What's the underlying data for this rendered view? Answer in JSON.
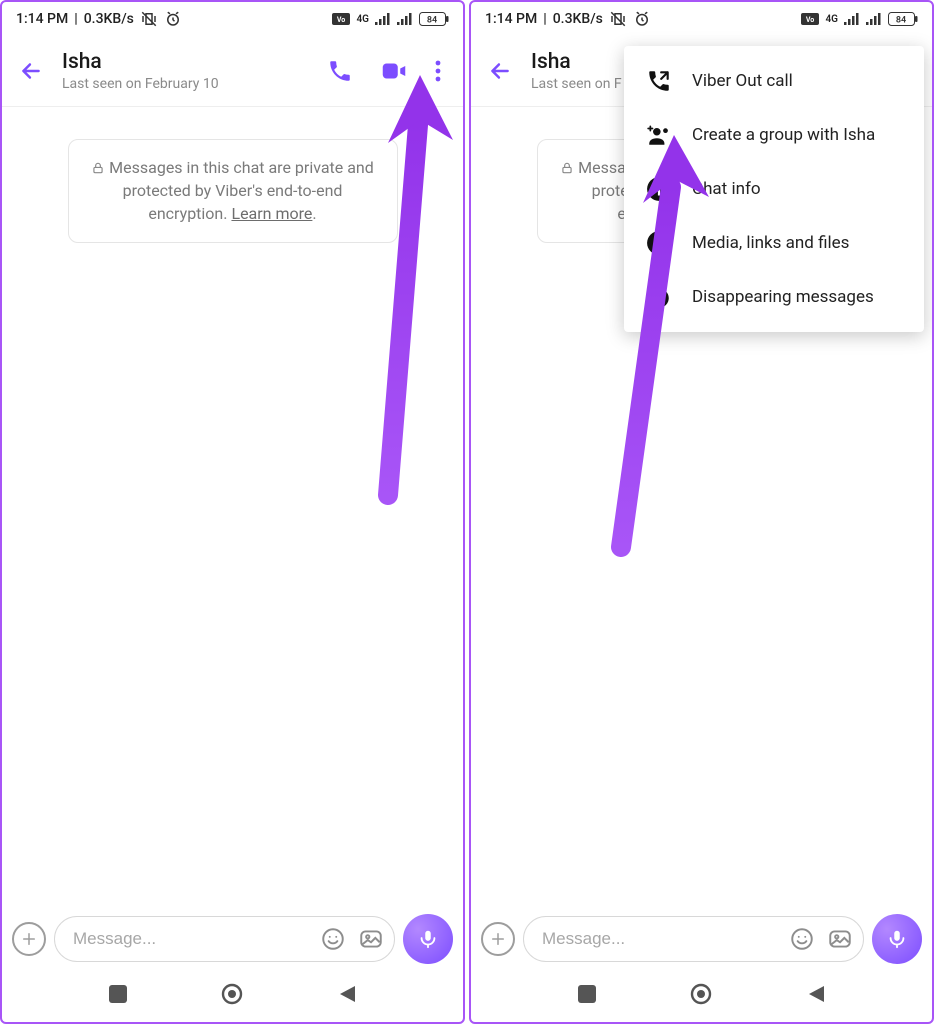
{
  "status": {
    "time": "1:14 PM",
    "net_speed": "0.3KB/s",
    "battery": "84"
  },
  "header": {
    "name": "Isha",
    "lastseen": "Last seen on February 10"
  },
  "encrypt": {
    "line": "Messages in this chat are private and protected by Viber's end-to-end encryption. ",
    "learn": "Learn more"
  },
  "composer": {
    "placeholder": "Message..."
  },
  "menu": {
    "items": [
      "Viber Out call",
      "Create a group with Isha",
      "Chat info",
      "Media, links and files",
      "Disappearing messages"
    ]
  }
}
